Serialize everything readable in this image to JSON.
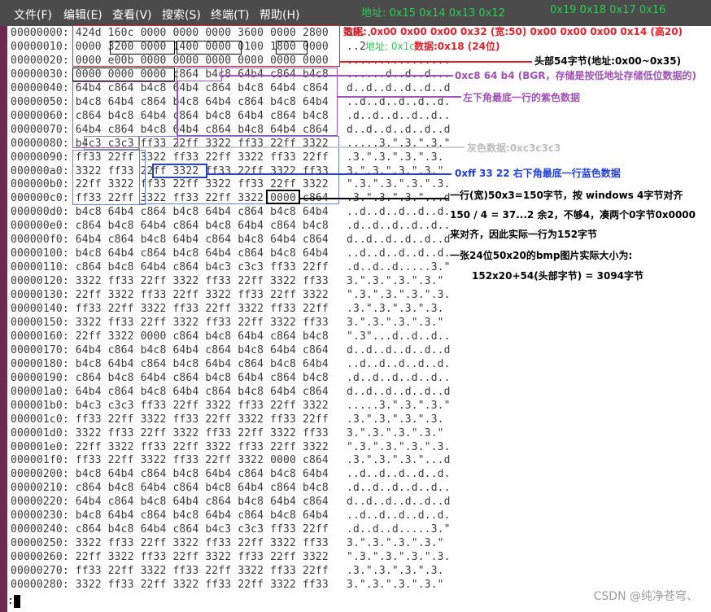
{
  "menubar": {
    "items": [
      "文件(F)",
      "编辑(E)",
      "查看(V)",
      "搜索(S)",
      "终端(T)",
      "帮助(H)"
    ],
    "addr_hint_left": "地址: 0x15 0x14 0x13 0x12",
    "addr_hint_right": "0x19 0x18 0x17 0x16"
  },
  "hexdump": {
    "lines": [
      {
        "offset": "00000000:",
        "hex": "424d 160c 0000 0000 0000 3600 0000 2800",
        "ascii": "BM.."
      },
      {
        "offset": "00000010:",
        "hex": "0000 3200 0000 1400 0000 0100 1800 0000",
        "ascii": "..2"
      },
      {
        "offset": "00000020:",
        "hex": "0000 e00b 0000 0000 0000 0000 0000 0000",
        "ascii": "................"
      },
      {
        "offset": "00000030:",
        "hex": "0000 0000 0000 c864 b4c8 64b4 c864 b4c8",
        "ascii": "......d..d..d..."
      },
      {
        "offset": "00000040:",
        "hex": "64b4 c864 b4c8 64b4 c864 b4c8 64b4 c864",
        "ascii": "d..d..d..d..d..d"
      },
      {
        "offset": "00000050:",
        "hex": "b4c8 64b4 c864 b4c8 64b4 c864 b4c8 64b4",
        "ascii": "..d..d..d..d..d."
      },
      {
        "offset": "00000060:",
        "hex": "c864 b4c8 64b4 c864 b4c8 64b4 c864 b4c8",
        "ascii": ".d..d..d..d..d.."
      },
      {
        "offset": "00000070:",
        "hex": "64b4 c864 b4c8 64b4 c864 b4c8 64b4 c864",
        "ascii": "d..d..d..d..d..d"
      },
      {
        "offset": "00000080:",
        "hex": "b4c3 c3c3 ff33 22ff 3322 ff33 22ff 3322",
        "ascii": ".....3.\".3.\".3.\""
      },
      {
        "offset": "00000090:",
        "hex": "ff33 22ff 3322 ff33 22ff 3322 ff33 22ff",
        "ascii": ".3.\".3.\".3.\".3."
      },
      {
        "offset": "000000a0:",
        "hex": "3322 ff33 22ff 3322 ff33 22ff 3322 ff33",
        "ascii": "3.\".3.\".3.\".3.\""
      },
      {
        "offset": "000000b0:",
        "hex": "22ff 3322 ff33 22ff 3322 ff33 22ff 3322",
        "ascii": "\".3.\".3.\".3.\".3."
      },
      {
        "offset": "000000c0:",
        "hex": "ff33 22ff 3322 ff33 22ff 3322 0000 c864",
        "ascii": ".3.\".3.\".3.\"...d"
      },
      {
        "offset": "000000d0:",
        "hex": "b4c8 64b4 c864 b4c8 64b4 c864 b4c8 64b4",
        "ascii": "..d..d..d..d..d."
      },
      {
        "offset": "000000e0:",
        "hex": "c864 b4c8 64b4 c864 b4c8 64b4 c864 b4c8",
        "ascii": ".d..d..d..d..d.."
      },
      {
        "offset": "000000f0:",
        "hex": "64b4 c864 b4c8 64b4 c864 b4c8 64b4 c864",
        "ascii": "d..d..d..d..d..d"
      },
      {
        "offset": "00000100:",
        "hex": "b4c8 64b4 c864 b4c8 64b4 c864 b4c8 64b4",
        "ascii": "..d..d..d..d..d."
      },
      {
        "offset": "00000110:",
        "hex": "c864 b4c8 64b4 c864 b4c3 c3c3 ff33 22ff",
        "ascii": ".d..d..d.....3.\""
      },
      {
        "offset": "00000120:",
        "hex": "3322 ff33 22ff 3322 ff33 22ff 3322 ff33",
        "ascii": "3.\".3.\".3.\".3.\""
      },
      {
        "offset": "00000130:",
        "hex": "22ff 3322 ff33 22ff 3322 ff33 22ff 3322",
        "ascii": "\".3.\".3.\".3.\".3."
      },
      {
        "offset": "00000140:",
        "hex": "ff33 22ff 3322 ff33 22ff 3322 ff33 22ff",
        "ascii": ".3.\".3.\".3.\".3."
      },
      {
        "offset": "00000150:",
        "hex": "3322 ff33 22ff 3322 ff33 22ff 3322 ff33",
        "ascii": "3.\".3.\".3.\".3.\""
      },
      {
        "offset": "00000160:",
        "hex": "22ff 3322 0000 c864 b4c8 64b4 c864 b4c8",
        "ascii": "\".3\"...d..d..d.."
      },
      {
        "offset": "00000170:",
        "hex": "64b4 c864 b4c8 64b4 c864 b4c8 64b4 c864",
        "ascii": "d..d..d..d..d..d"
      },
      {
        "offset": "00000180:",
        "hex": "b4c8 64b4 c864 b4c8 64b4 c864 b4c8 64b4",
        "ascii": "..d..d..d..d..d."
      },
      {
        "offset": "00000190:",
        "hex": "c864 b4c8 64b4 c864 b4c8 64b4 c864 b4c8",
        "ascii": ".d..d..d..d..d.."
      },
      {
        "offset": "000001a0:",
        "hex": "64b4 c864 b4c8 64b4 c864 b4c8 64b4 c864",
        "ascii": "d..d..d..d..d..d"
      },
      {
        "offset": "000001b0:",
        "hex": "b4c3 c3c3 ff33 22ff 3322 ff33 22ff 3322",
        "ascii": ".....3.\".3.\".3.\""
      },
      {
        "offset": "000001c0:",
        "hex": "ff33 22ff 3322 ff33 22ff 3322 ff33 22ff",
        "ascii": ".3.\".3.\".3.\".3."
      },
      {
        "offset": "000001d0:",
        "hex": "3322 ff33 22ff 3322 ff33 22ff 3322 ff33",
        "ascii": "3.\".3.\".3.\".3.\""
      },
      {
        "offset": "000001e0:",
        "hex": "22ff 3322 ff33 22ff 3322 ff33 22ff 3322",
        "ascii": "\".3.\".3.\".3.\".3."
      },
      {
        "offset": "000001f0:",
        "hex": "ff33 22ff 3322 ff33 22ff 3322 0000 c864",
        "ascii": ".3.\".3.\".3.\"...d"
      },
      {
        "offset": "00000200:",
        "hex": "b4c8 64b4 c864 b4c8 64b4 c864 b4c8 64b4",
        "ascii": "..d..d..d..d..d."
      },
      {
        "offset": "00000210:",
        "hex": "c864 b4c8 64b4 c864 b4c8 64b4 c864 b4c8",
        "ascii": ".d..d..d..d..d.."
      },
      {
        "offset": "00000220:",
        "hex": "64b4 c864 b4c8 64b4 c864 b4c8 64b4 c864",
        "ascii": "d..d..d..d..d..d"
      },
      {
        "offset": "00000230:",
        "hex": "b4c8 64b4 c864 b4c8 64b4 c864 b4c8 64b4",
        "ascii": "..d..d..d..d..d."
      },
      {
        "offset": "00000240:",
        "hex": "c864 b4c8 64b4 c864 b4c3 c3c3 ff33 22ff",
        "ascii": ".d..d..d.....3.\""
      },
      {
        "offset": "00000250:",
        "hex": "3322 ff33 22ff 3322 ff33 22ff 3322 ff33",
        "ascii": "3.\".3.\".3.\".3.\""
      },
      {
        "offset": "00000260:",
        "hex": "22ff 3322 ff33 22ff 3322 ff33 22ff 3322",
        "ascii": "\".3.\".3.\".3.\".3."
      },
      {
        "offset": "00000270:",
        "hex": "ff33 22ff 3322 ff33 22ff 3322 ff33 22ff",
        "ascii": ".3.\".3.\".3.\".3."
      },
      {
        "offset": "00000280:",
        "hex": "3322 ff33 22ff 3322 ff33 22ff 3322 ff33",
        "ascii": "3.\".3.\".3.\".3.\""
      }
    ]
  },
  "annotations": {
    "data_note": "数据: 0x00 0x00 0x00 0x32 (宽:50) 0x00 0x00 0x00 0x14 (高20)",
    "addr_note": "地址: 0x1c",
    "data_note2": "数据:0x18  (24位)",
    "header_note": "头部54字节(地址:0x00~0x35)",
    "bgr_note": "0xc8 64 b4 (BGR，存储是按低地址存储低位数据的)",
    "purple_note": "左下角最底一行的紫色数据",
    "gray_note": "灰色数据:0xc3c3c3",
    "blue_note": "0xff 33 22  右下角最底一行蓝色数据",
    "row_note1": "一行(宽)50x3=150字节，按 windows 4字节对齐",
    "row_note2": "150 / 4 = 37...2 余2，不够4，凑两个0字节0x0000",
    "row_note3": "来对齐，因此实际一行为152字节",
    "size_note1": "一张24位50x20的bmp图片实际大小为:",
    "size_note2": "152x20+54(头部字节) = 3094字节"
  },
  "colors": {
    "red": "#e8202a",
    "green": "#2ecc52",
    "purple": "#a050b8",
    "blue": "#2040e0",
    "gray": "#bdbdbd",
    "black": "#000000"
  },
  "watermark": "CSDN @纯净苍穹、",
  "prompt": ":"
}
